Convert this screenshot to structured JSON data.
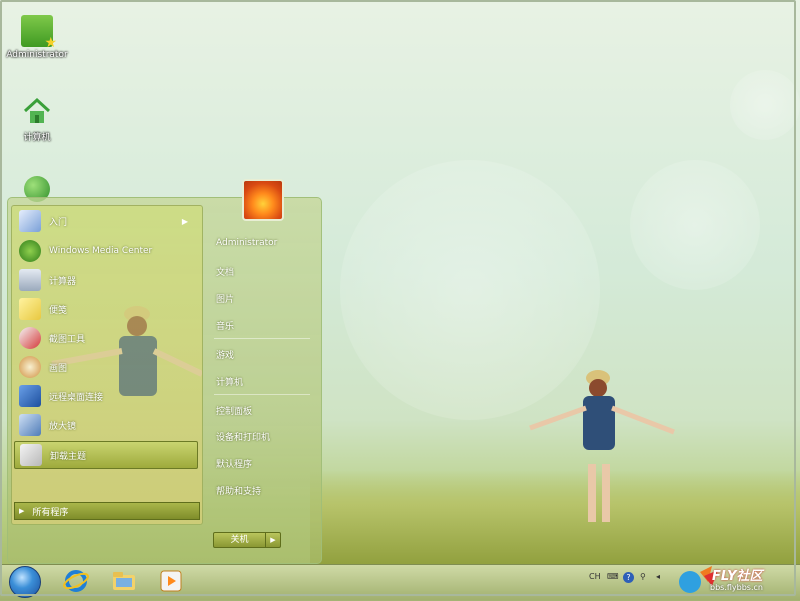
{
  "desktop": {
    "icons": [
      {
        "label": "Administrator",
        "icon": "user-folder-icon"
      },
      {
        "label": "计算机",
        "icon": "computer-home-icon"
      },
      {
        "label": "",
        "icon": "network-globe-icon"
      }
    ]
  },
  "start_menu": {
    "left_items": [
      {
        "label": "入门",
        "icon": "getting-started-icon",
        "has_submenu": true
      },
      {
        "label": "Windows Media Center",
        "icon": "media-center-icon"
      },
      {
        "label": "计算器",
        "icon": "calculator-icon"
      },
      {
        "label": "便笺",
        "icon": "sticky-notes-icon"
      },
      {
        "label": "截图工具",
        "icon": "snipping-tool-icon"
      },
      {
        "label": "画图",
        "icon": "paint-icon"
      },
      {
        "label": "远程桌面连接",
        "icon": "remote-desktop-icon"
      },
      {
        "label": "放大镜",
        "icon": "magnifier-icon"
      },
      {
        "label": "卸载主题",
        "icon": "uninstall-theme-icon",
        "selected": true
      }
    ],
    "all_programs": "所有程序",
    "right_items": [
      "Administrator",
      "文档",
      "图片",
      "音乐",
      "游戏",
      "计算机",
      "控制面板",
      "设备和打印机",
      "默认程序",
      "帮助和支持"
    ],
    "shutdown_label": "关机"
  },
  "taskbar": {
    "pinned": [
      "start-orb-icon",
      "internet-explorer-icon",
      "windows-explorer-icon",
      "media-player-icon"
    ],
    "tray": {
      "language": "CH",
      "icons": [
        "keyboard-icon",
        "help-icon",
        "network-icon",
        "volume-icon"
      ]
    }
  },
  "watermark": {
    "logo": "FLY社区",
    "url": "bbs.flybbs.cn"
  },
  "colors": {
    "accent": "#9eaa3c",
    "menu_bg": "#c6d688"
  }
}
